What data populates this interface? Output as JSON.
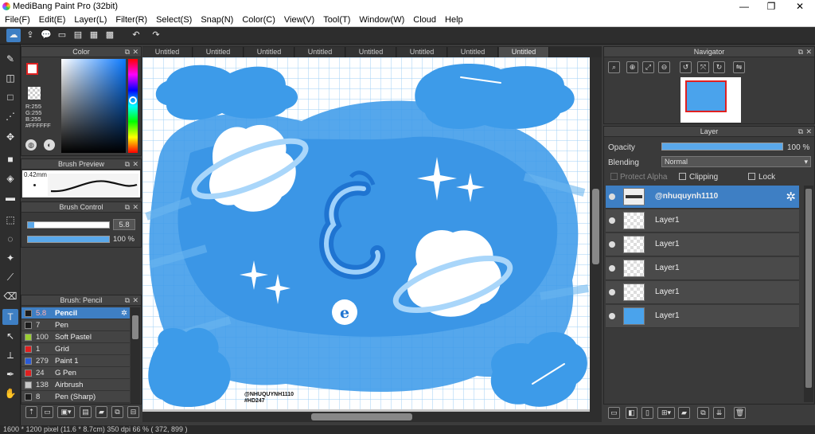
{
  "app": {
    "title": "MediBang Paint Pro (32bit)",
    "window_buttons": [
      "—",
      "❐",
      "✕"
    ]
  },
  "menu": [
    "File(F)",
    "Edit(E)",
    "Layer(L)",
    "Filter(R)",
    "Select(S)",
    "Snap(N)",
    "Color(C)",
    "View(V)",
    "Tool(T)",
    "Window(W)",
    "Cloud",
    "Help"
  ],
  "tabs": [
    "Untitled",
    "Untitled",
    "Untitled",
    "Untitled",
    "Untitled",
    "Untitled",
    "Untitled",
    "Untitled"
  ],
  "color_panel": {
    "title": "Color",
    "r": "R:255",
    "g": "G:255",
    "b": "B:255",
    "hex": "#FFFFFF"
  },
  "brush_preview": {
    "title": "Brush Preview",
    "size": "0.42mm"
  },
  "brush_control": {
    "title": "Brush Control",
    "size": "5.8",
    "opacity": "100 %"
  },
  "brush_list": {
    "title": "Brush: Pencil",
    "items": [
      {
        "size": "5.8",
        "name": "Pencil",
        "color": "#1c1c1c"
      },
      {
        "size": "7",
        "name": "Pen",
        "color": "#1c1c1c"
      },
      {
        "size": "100",
        "name": "Soft Pastel",
        "color": "#9acd32"
      },
      {
        "size": "1",
        "name": "Grid",
        "color": "#e02020"
      },
      {
        "size": "279",
        "name": "Paint 1",
        "color": "#2a5bd7"
      },
      {
        "size": "24",
        "name": "G Pen",
        "color": "#e02020"
      },
      {
        "size": "138",
        "name": "Airbrush",
        "color": "#c8c8c8"
      },
      {
        "size": "8",
        "name": "Pen (Sharp)",
        "color": "#1c1c1c"
      }
    ]
  },
  "navigator": {
    "title": "Navigator"
  },
  "layer_panel": {
    "title": "Layer",
    "opacity_label": "Opacity",
    "opacity_value": "100 %",
    "blending_label": "Blending",
    "blending_value": "Normal",
    "protect_alpha": "Protect Alpha",
    "clipping": "Clipping",
    "lock": "Lock",
    "layers": [
      "@nhuquynh1110",
      "Layer1",
      "Layer1",
      "Layer1",
      "Layer1",
      "Layer1"
    ]
  },
  "canvas_text": {
    "signature_line1": "@NHUQUYNH1110",
    "signature_line2": "#HD247"
  },
  "status": {
    "text": "1600 * 1200 pixel   (11.6 * 8.7cm)   350 dpi   66 %   ( 372, 899 )"
  },
  "colors": {
    "accent": "#3e7fc4",
    "canvas_blue": "#3d9be9",
    "grid": "#9fcff5"
  }
}
